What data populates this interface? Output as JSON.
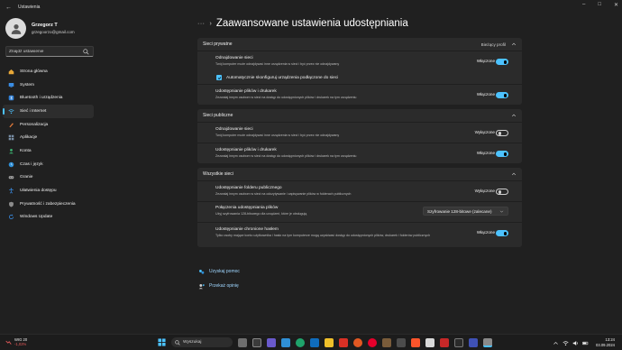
{
  "window": {
    "title": "Ustawienia",
    "controls": [
      "–",
      "□",
      "✕"
    ]
  },
  "profile": {
    "name": "Grzegorz T",
    "email": "grzegoorzo@gmail.com"
  },
  "search": {
    "placeholder": "Znajdź ustawienie"
  },
  "nav": {
    "items": [
      {
        "label": "Strona główna",
        "icon": "home-icon"
      },
      {
        "label": "System",
        "icon": "monitor-icon"
      },
      {
        "label": "Bluetooth i urządzenia",
        "icon": "bluetooth-icon"
      },
      {
        "label": "Sieć i Internet",
        "icon": "wifi-icon",
        "active": true
      },
      {
        "label": "Personalizacja",
        "icon": "brush-icon"
      },
      {
        "label": "Aplikacje",
        "icon": "apps-icon"
      },
      {
        "label": "Konta",
        "icon": "account-icon"
      },
      {
        "label": "Czas i język",
        "icon": "globe-clock-icon"
      },
      {
        "label": "Granie",
        "icon": "gamepad-icon"
      },
      {
        "label": "Ułatwienia dostępu",
        "icon": "accessibility-icon"
      },
      {
        "label": "Prywatność i zabezpieczenia",
        "icon": "shield-icon"
      },
      {
        "label": "Windows Update",
        "icon": "update-icon"
      }
    ]
  },
  "breadcrumb": {
    "dots": "···",
    "sep": "›",
    "title": "Zaawansowane ustawienia udostępniania"
  },
  "sections": {
    "private": {
      "title": "Sieci prywatne",
      "badge": "Bieżący profil",
      "discovery": {
        "title": "Odnajdowanie sieci",
        "desc": "Twój komputer może odnajdywać inne urządzenia w sieci i być przez nie odnajdywany",
        "state": "Włączone",
        "on": true
      },
      "autoconfig": {
        "label": "Automatycznie skonfiguruj urządzenia podłączone do sieci",
        "checked": true
      },
      "sharing": {
        "title": "Udostępnianie plików i drukarek",
        "desc": "Zezwalaj innym osobom w sieci na dostęp do udostępnionych plików i drukarek na tym urządzeniu",
        "state": "Włączone",
        "on": true
      }
    },
    "public": {
      "title": "Sieci publiczne",
      "discovery": {
        "title": "Odnajdowanie sieci",
        "desc": "Twój komputer może odnajdywać inne urządzenia w sieci i być przez nie odnajdywany",
        "state": "Wyłączone",
        "on": false
      },
      "sharing": {
        "title": "Udostępnianie plików i drukarek",
        "desc": "Zezwalaj innym osobom w sieci na dostęp do udostępnionych plików i drukarek na tym urządzeniu",
        "state": "Włączone",
        "on": true
      }
    },
    "all": {
      "title": "Wszystkie sieci",
      "public_folder": {
        "title": "Udostępnianie folderu publicznego",
        "desc": "Zezwalaj innym osobom w sieci na odczytywanie i zapisywanie plików w folderach publicznych",
        "state": "Wyłączone",
        "on": false
      },
      "encryption": {
        "title": "Połączenia udostępniania plików",
        "desc": "Użyj szyfrowania 128-bitowego dla urządzeń, które je obsługują",
        "value": "Szyfrowanie 128-bitowe (zalecane)"
      },
      "password": {
        "title": "Udostępnianie chronione hasłem",
        "desc": "Tylko osoby mające konto użytkownika i hasło na tym komputerze mogą uzyskiwać dostęp do udostępnionych plików, drukarek i folderów publicznych",
        "state": "Włączone",
        "on": true
      }
    }
  },
  "links": {
    "help": "Uzyskaj pomoc",
    "feedback": "Przekaż opinię"
  },
  "taskbar": {
    "weather_index": "WIG 20",
    "weather_change": "-1,02%",
    "search_placeholder": "Wyszukaj",
    "time": "13:24",
    "date": "03.09.2024",
    "accent": "#4cc2ff"
  }
}
